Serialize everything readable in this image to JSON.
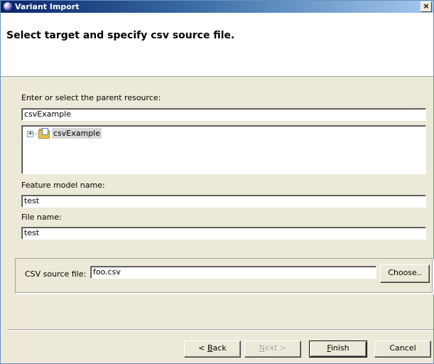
{
  "window": {
    "title": "Variant Import",
    "close_label": "×"
  },
  "banner": {
    "heading": "Select target and specify csv source file."
  },
  "parent": {
    "label": "Enter or select the parent resource:",
    "value": "csvExample",
    "tree": [
      {
        "label": "csvExample",
        "expander": "+",
        "selected": true
      }
    ]
  },
  "feature": {
    "label": "Feature model name:",
    "value": "test"
  },
  "file": {
    "label": "File name:",
    "value": "test"
  },
  "csv": {
    "label": "CSV source file:",
    "value": "foo.csv",
    "choose_label": "Choose.."
  },
  "buttons": {
    "back": {
      "prefix": "< ",
      "mnemonic": "B",
      "rest": "ack",
      "enabled": true
    },
    "next": {
      "mnemonic": "N",
      "rest": "ext >",
      "enabled": false
    },
    "finish": {
      "mnemonic": "F",
      "rest": "inish",
      "enabled": true,
      "default": true
    },
    "cancel": {
      "label": "Cancel",
      "enabled": true
    }
  }
}
